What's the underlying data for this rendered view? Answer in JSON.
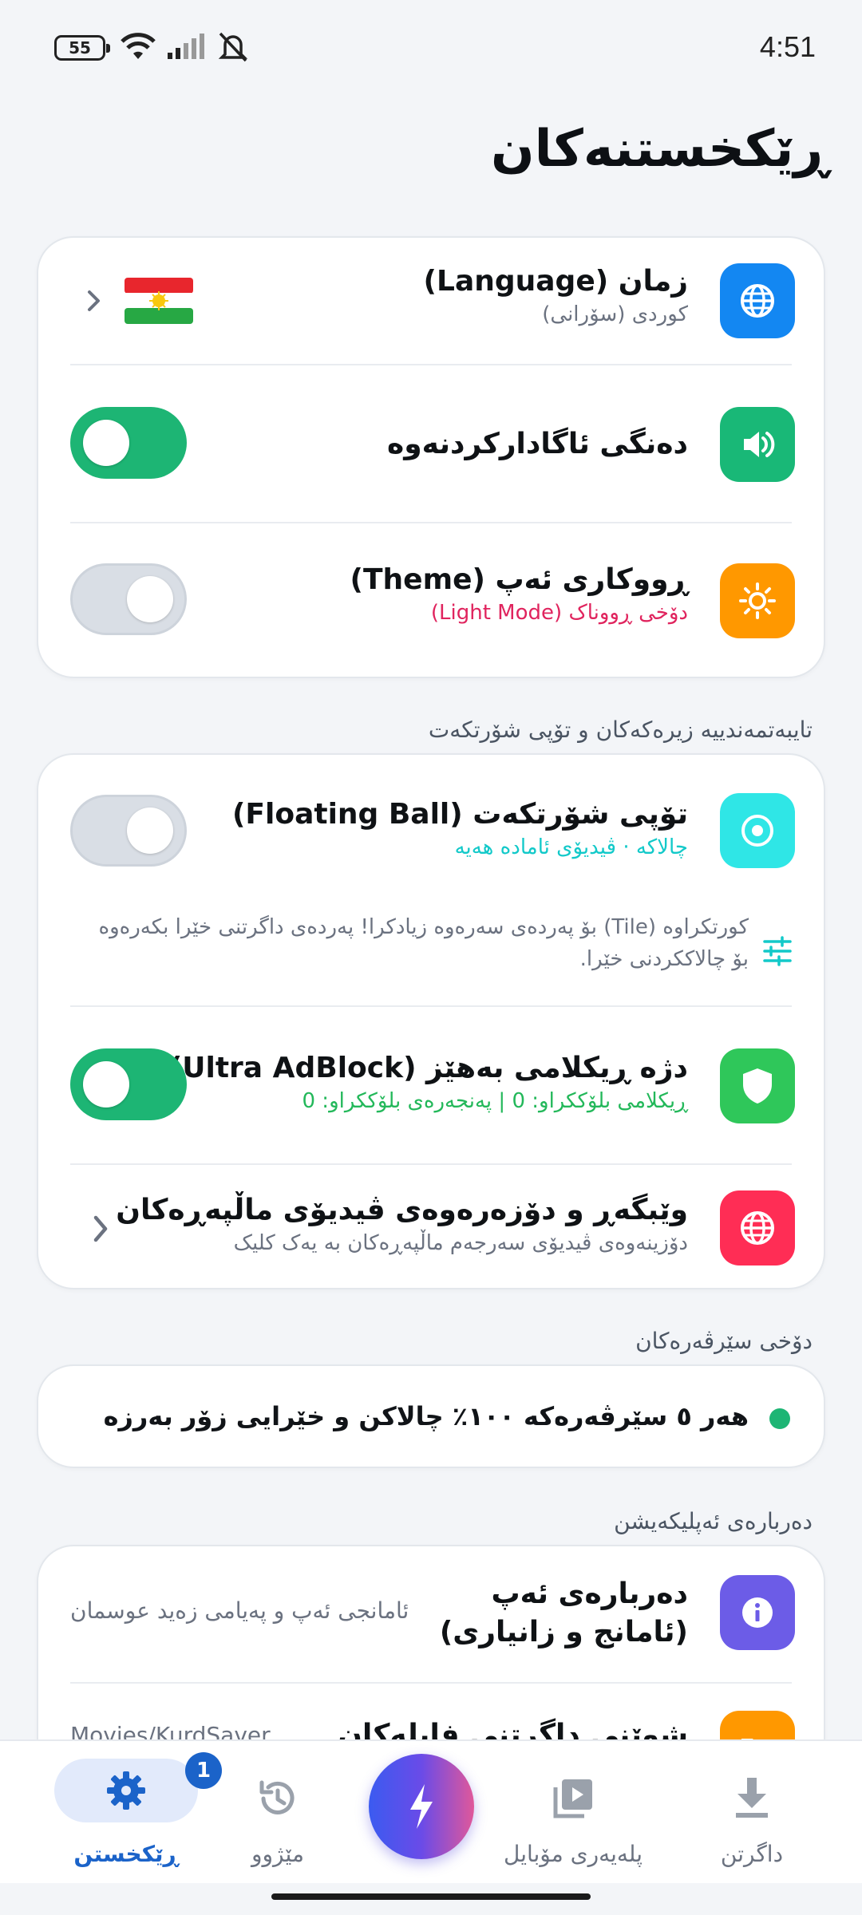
{
  "status_bar": {
    "battery": "55",
    "time": "4:51"
  },
  "page_title": "ڕێکخستنەکان",
  "general": {
    "language": {
      "title": "زمان (Language)",
      "subtitle": "کوردی (سۆرانی)"
    },
    "sound": {
      "title": "دەنگی ئاگادارکردنەوە",
      "enabled": true
    },
    "theme": {
      "title": "ڕووکاری ئەپ (Theme)",
      "subtitle": "دۆخی ڕووناک (Light Mode)",
      "enabled": false
    }
  },
  "smart_section_label": "تایبەتمەندییە زیرەکەکان و تۆپی شۆرتکەت",
  "smart": {
    "floating_ball": {
      "title": "تۆپی شۆرتکەت (Floating Ball)",
      "subtitle": "چالاکە · ڤیدیۆی ئامادە هەیە",
      "enabled": false
    },
    "tile_note": "کورتکراوە (Tile) بۆ پەردەی سەرەوە زیادکرا! پەردەی داگرتنی خێرا بکەرەوە بۆ چالاککردنی خێرا.",
    "adblock": {
      "title": "دژە ڕیکلامی بەهێز (Ultra AdBlock)",
      "subtitle": "ڕیکلامی بلۆککراو: 0 | پەنجەرەی بلۆککراو: 0",
      "enabled": true
    },
    "browser": {
      "title": "وێبگەڕ و دۆزەرەوەی ڤیدیۆی ماڵپەڕەکان",
      "subtitle": "دۆزینەوەی ڤیدیۆی سەرجەم ماڵپەڕەکان بە یەک کلیک"
    }
  },
  "servers_section_label": "دۆخی سێرڤەرەکان",
  "servers_status": "هەر ٥ سێرڤەرەکە ١٠٠٪ چالاکن و خێرایی زۆر بەرزە",
  "about_section_label": "دەربارەی ئەپلیکەیشن",
  "about": {
    "title": "دەربارەی ئەپ (ئامانج و زانیاری)",
    "side_text": "ئامانجی ئەپ و پەیامی زەید عوسمان",
    "next_partial_title": "شوێنی داگرتنی فایلەکان",
    "next_partial_side": "Movies/KurdSaver"
  },
  "nav": {
    "settings": "ڕێکخستن",
    "history": "مێژوو",
    "history_badge": "1",
    "player": "پلەیەری مۆبایل",
    "downloads": "داگرتن"
  },
  "colors": {
    "accent": "#1b63c9",
    "language_icon": "#1387f2",
    "sound_icon": "#19b877",
    "theme_icon": "#ff9800",
    "floating_icon": "#2fe6e6",
    "adblock_icon": "#2fc75a",
    "browser_icon": "#ff2d55",
    "about_icon": "#6c5ce7",
    "theme_subtitle": "#e0245e",
    "floating_subtitle": "#12c9c9",
    "adblock_subtitle": "#23b85a"
  }
}
